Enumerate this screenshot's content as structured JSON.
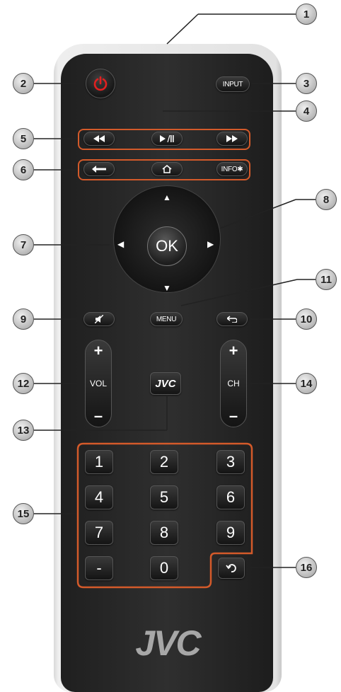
{
  "callouts": [
    "1",
    "2",
    "3",
    "4",
    "5",
    "6",
    "7",
    "8",
    "9",
    "10",
    "11",
    "12",
    "13",
    "14",
    "15",
    "16"
  ],
  "buttons": {
    "input": "INPUT",
    "info": "INFO✱",
    "menu": "MENU",
    "ok": "OK",
    "jvc": "JVC",
    "vol": "VOL",
    "ch": "CH",
    "plus": "+",
    "minus": "–",
    "digits": [
      "1",
      "2",
      "3",
      "4",
      "5",
      "6",
      "7",
      "8",
      "9",
      "-",
      "0"
    ]
  },
  "brand": "JVC",
  "accent_color": "#d45a2a",
  "power_color": "#e02020",
  "icons": [
    "power-icon",
    "rewind-icon",
    "play-pause-icon",
    "fast-forward-icon",
    "back-arrow-icon",
    "home-icon",
    "up-arrow-icon",
    "down-arrow-icon",
    "left-arrow-icon",
    "right-arrow-icon",
    "mute-icon",
    "return-icon",
    "recall-icon"
  ]
}
